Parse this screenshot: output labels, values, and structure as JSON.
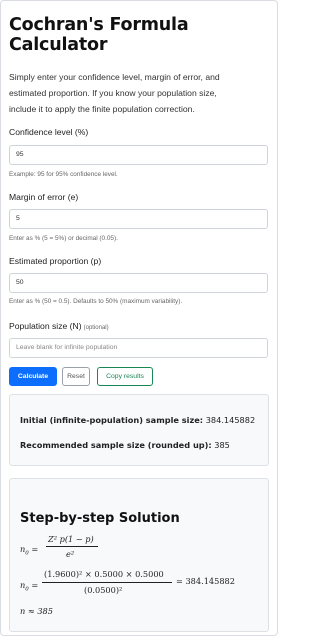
{
  "title_line1": "Cochran's Formula",
  "title_line2": "Calculator",
  "intro": {
    "line1": "Simply enter your confidence level, margin of error, and",
    "line2": "estimated proportion. If you know your population size,",
    "line3": "include it to apply the finite population correction."
  },
  "confidence": {
    "label": "Confidence level (%)",
    "value": "95",
    "help": "Example: 95 for 95% confidence level."
  },
  "margin": {
    "label": "Margin of error (e)",
    "value": "5",
    "help": "Enter as % (5 = 5%) or decimal (0.05)."
  },
  "proportion": {
    "label": "Estimated proportion (p)",
    "value": "50",
    "help": "Enter as % (50 = 0.5). Defaults to 50% (maximum variability)."
  },
  "population": {
    "label": "Population size (N)",
    "optional": "(optional)",
    "placeholder": "Leave blank for infinite population"
  },
  "buttons": {
    "calculate": "Calculate",
    "reset": "Reset",
    "copy": "Copy results"
  },
  "results": {
    "initial_label": "Initial (infinite-population) sample size:",
    "initial_value": "384.145882",
    "recommended_label": "Recommended sample size (rounded up):",
    "recommended_value": "385"
  },
  "steps": {
    "title": "Step-by-step Solution",
    "n0": "n",
    "sub0": "0",
    "eq": "=",
    "formula_num": "Z² p(1 − p)",
    "formula_den": "e²",
    "calc_num": "(1.9600)² × 0.5000 × 0.5000",
    "calc_den": "(0.0500)²",
    "calc_result": "= 384.145882",
    "final": "n ≈ 385"
  },
  "colors": {
    "primary": "#0d6efd",
    "success": "#198754",
    "card_bg": "#f8f9fa"
  }
}
